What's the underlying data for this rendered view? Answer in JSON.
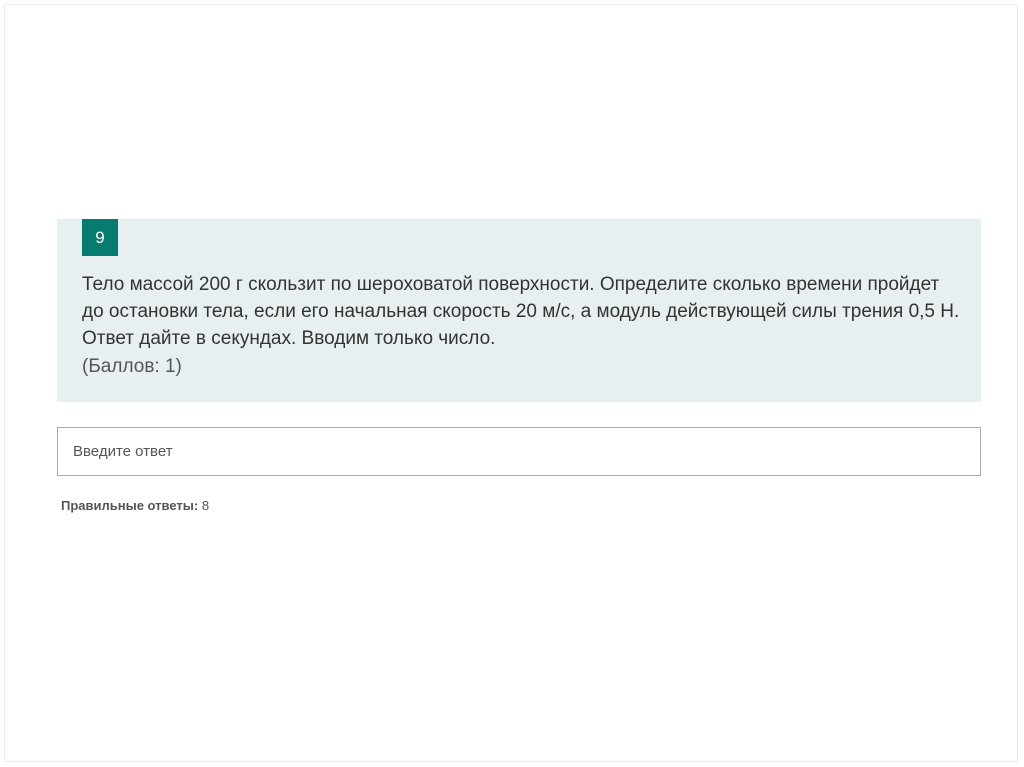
{
  "question": {
    "number": "9",
    "text": "Тело массой 200 г скользит по шероховатой поверхности. Определите сколько времени пройдет до остановки тела, если его начальная скорость 20 м/с, а модуль действующей силы трения 0,5 Н. Ответ дайте в секундах. Вводим только число.",
    "points": "(Баллов: 1)"
  },
  "answer": {
    "placeholder": "Введите ответ",
    "value": ""
  },
  "correct_answers": {
    "label": "Правильные ответы:",
    "value": "8"
  },
  "colors": {
    "card_background": "#e7eff1",
    "number_badge": "#077b6f",
    "input_border": "#aaaaaa"
  }
}
